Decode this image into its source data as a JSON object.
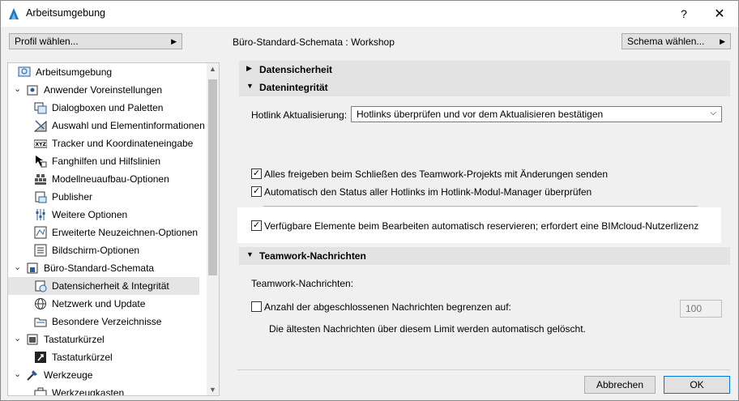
{
  "window": {
    "title": "Arbeitsumgebung",
    "help_label": "?",
    "close_label": "✕"
  },
  "toolbar": {
    "profile_button": "Profil wählen...",
    "header_title": "Büro-Standard-Schemata : Workshop",
    "schema_button": "Schema wählen..."
  },
  "tree": {
    "items": [
      {
        "label": "Arbeitsumgebung",
        "icon": "workspace-icon"
      },
      {
        "label": "Anwender Voreinstellungen",
        "icon": "user-settings-icon"
      },
      {
        "label": "Dialogboxen und Paletten",
        "icon": "dialog-palette-icon"
      },
      {
        "label": "Auswahl und Elementinformationen",
        "icon": "selection-icon"
      },
      {
        "label": "Tracker und Koordinateneingabe",
        "icon": "xyz-tracker-icon"
      },
      {
        "label": "Fanghilfen und Hilfslinien",
        "icon": "snap-guides-icon"
      },
      {
        "label": "Modellneuaufbau-Optionen",
        "icon": "model-rebuild-icon"
      },
      {
        "label": "Publisher",
        "icon": "publisher-icon"
      },
      {
        "label": "Weitere Optionen",
        "icon": "more-options-icon"
      },
      {
        "label": "Erweiterte Neuzeichnen-Optionen",
        "icon": "redraw-options-icon"
      },
      {
        "label": "Bildschirm-Optionen",
        "icon": "screen-options-icon"
      },
      {
        "label": "Büro-Standard-Schemata",
        "icon": "office-standard-icon"
      },
      {
        "label": "Datensicherheit & Integrität",
        "icon": "data-safety-icon"
      },
      {
        "label": "Netzwerk und Update",
        "icon": "network-globe-icon"
      },
      {
        "label": "Besondere Verzeichnisse",
        "icon": "folder-icon"
      },
      {
        "label": "Tastaturkürzel",
        "icon": "shortcuts-group-icon"
      },
      {
        "label": "Tastaturkürzel",
        "icon": "shortcuts-icon"
      },
      {
        "label": "Werkzeuge",
        "icon": "tools-group-icon"
      },
      {
        "label": "Werkzeugkasten",
        "icon": "toolbox-icon"
      }
    ]
  },
  "panel": {
    "section_datensicherheit": "Datensicherheit",
    "section_datenintegritaet": "Datenintegrität",
    "hotlink_label": "Hotlink Aktualisierung:",
    "hotlink_value": "Hotlinks überprüfen und vor dem Aktualisieren bestätigen",
    "cb_release": "Alles freigeben beim Schließen des Teamwork-Projekts mit Änderungen senden",
    "cb_auto_status": "Automatisch den Status aller Hotlinks im Hotlink-Modul-Manager überprüfen",
    "cb_reserve": "Verfügbare Elemente beim Bearbeiten automatisch reservieren; erfordert eine BIMcloud-Nutzerlizenz",
    "section_teamwork": "Teamwork-Nachrichten",
    "teamwork_label": "Teamwork-Nachrichten:",
    "cb_limit": "Anzahl der abgeschlossenen Nachrichten begrenzen auf:",
    "limit_value": "100",
    "limit_note": "Die ältesten Nachrichten über diesem Limit werden automatisch gelöscht."
  },
  "checkbox_states": {
    "cb_release": true,
    "cb_auto_status": true,
    "cb_reserve": true,
    "cb_limit": false
  },
  "footer": {
    "cancel": "Abbrechen",
    "ok": "OK"
  },
  "colors": {
    "section_bar": "#e3e3e3",
    "selection": "#e5e5e5",
    "accent": "#0078d7"
  }
}
